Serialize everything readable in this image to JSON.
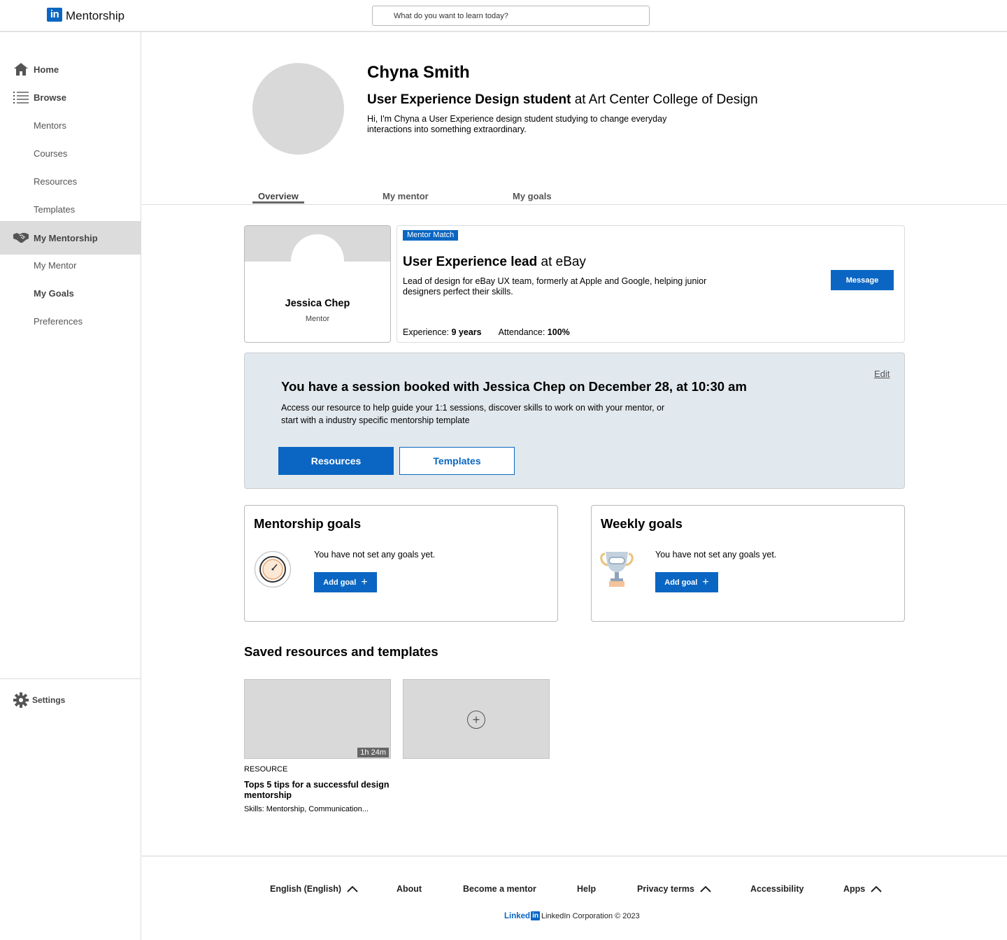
{
  "app": {
    "logo_badge": "in",
    "name": "Mentorship",
    "search_placeholder": "What do you want to learn today?"
  },
  "sidebar": {
    "items": [
      {
        "label": "Home",
        "icon": "home-icon"
      },
      {
        "label": "Browse",
        "icon": "list-icon"
      },
      {
        "label": "Mentors"
      },
      {
        "label": "Courses"
      },
      {
        "label": "Resources"
      },
      {
        "label": "Templates"
      },
      {
        "label": "My Mentorship",
        "icon": "handshake-icon",
        "active": true
      },
      {
        "label": "My Mentor"
      },
      {
        "label": "My Goals"
      },
      {
        "label": "Preferences"
      }
    ],
    "settings": {
      "label": "Settings",
      "icon": "gear-icon"
    }
  },
  "profile": {
    "name": "Chyna Smith",
    "headline_role": "User Experience Design student",
    "headline_org": " at Art Center College of Design",
    "bio": "Hi, I'm Chyna a User Experience design student studying to change everyday interactions into something extraordinary."
  },
  "tabs": [
    {
      "label": "Overview",
      "active": true
    },
    {
      "label": "My mentor"
    },
    {
      "label": "My goals"
    }
  ],
  "mentor": {
    "name": "Jessica Chep",
    "role": "Mentor",
    "badge": "Mentor Match",
    "title_role": "User Experience lead",
    "title_org": " at eBay",
    "description": "Lead of design for eBay UX team, formerly  at Apple and Google, helping junior designers perfect their skills.",
    "experience_label": "Experience: ",
    "experience_value": "9 years",
    "attendance_label": "Attendance: ",
    "attendance_value": "100%",
    "message_label": "Message"
  },
  "session": {
    "title": "You have a session booked with Jessica Chep on December 28, at 10:30 am",
    "description": "Access our resource to help guide your 1:1 sessions, discover skills to work on with your mentor, or start with a industry specific mentorship template",
    "edit_label": "Edit",
    "resources_label": "Resources",
    "templates_label": "Templates"
  },
  "goals": {
    "mentorship": {
      "title": "Mentorship goals",
      "empty": "You have not set any goals yet.",
      "button": "Add goal",
      "icon": "stopwatch-icon"
    },
    "weekly": {
      "title": "Weekly goals",
      "empty": "You have not set any goals yet.",
      "button": "Add goal",
      "icon": "trophy-icon"
    }
  },
  "saved": {
    "title": "Saved resources and templates",
    "items": [
      {
        "kind": "RESOURCE",
        "title": "Tops 5 tips for a successful design mentorship",
        "skills": "Skills:  Mentorship, Communication...",
        "duration": "1h 24m"
      }
    ],
    "add_icon": "plus-circle-icon"
  },
  "footer": {
    "links": [
      {
        "label": "English (English)",
        "chevron": true
      },
      {
        "label": "About"
      },
      {
        "label": "Become a mentor"
      },
      {
        "label": "Help"
      },
      {
        "label": "Privacy terms",
        "chevron": true
      },
      {
        "label": "Accessibility"
      },
      {
        "label": "Apps",
        "chevron": true
      }
    ],
    "brand_word": "Linked",
    "brand_badge": "in",
    "copyright": "LinkedIn Corporation © 2023"
  },
  "colors": {
    "brand": "#0a66c2",
    "session_bg": "#e2e9ee",
    "active_nav": "#dcdcdc"
  }
}
